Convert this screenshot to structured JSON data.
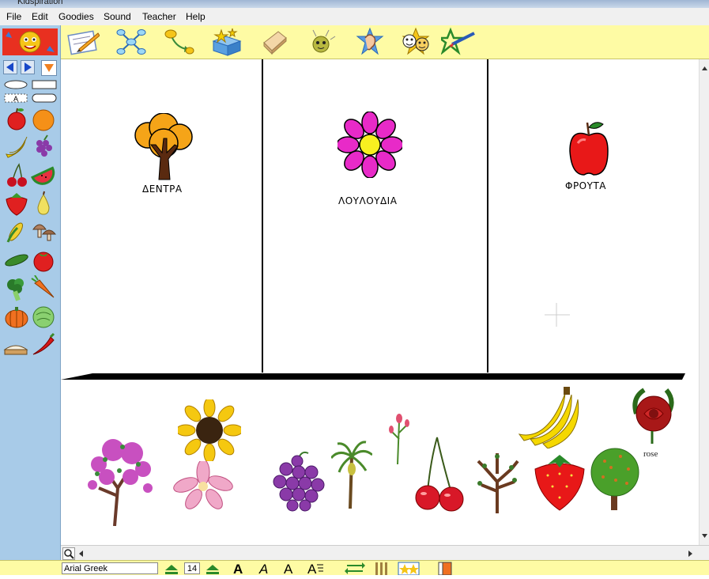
{
  "window": {
    "title": "Kidspiration"
  },
  "menu": [
    "File",
    "Edit",
    "Goodies",
    "Sound",
    "Teacher",
    "Help"
  ],
  "toolbar": {
    "items": [
      "notepad-pencil-icon",
      "network-map-icon",
      "link-arrow-icon",
      "symbol-box-icon",
      "eraser-icon",
      "bee-icon",
      "ear-icon",
      "faces-icon",
      "paintbrush-icon"
    ]
  },
  "sidebar": {
    "symbol_names": [
      "apple",
      "orange",
      "banana",
      "grapes",
      "cherries",
      "watermelon",
      "strawberry",
      "pear",
      "corn",
      "mushrooms",
      "cucumber",
      "tomato",
      "broccoli",
      "carrot",
      "pumpkin",
      "lettuce",
      "pie",
      "chili-pepper"
    ]
  },
  "categories": [
    {
      "label": "ΔΕΝΤΡΑ",
      "icon": "tree-icon"
    },
    {
      "label": "ΛΟΥΛΟΥΔΙΑ",
      "icon": "flower-icon"
    },
    {
      "label": "ΦΡΟΥΤΑ",
      "icon": "apple-icon"
    }
  ],
  "pictures": {
    "rose_label": "rose"
  },
  "bottombar": {
    "font_name": "Arial Greek",
    "font_size": "14"
  },
  "colors": {
    "toolbar_bg": "#fefba4",
    "sidebar_bg": "#a8cbe8"
  }
}
